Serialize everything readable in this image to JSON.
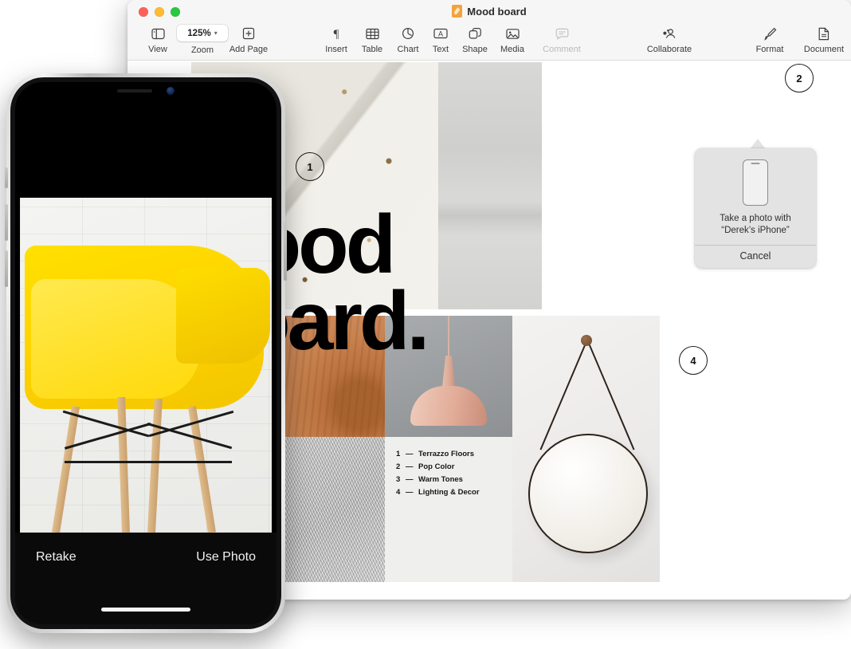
{
  "window": {
    "title": "Mood board",
    "doc_icon": "pages-document-icon",
    "traffic_lights": [
      {
        "name": "close",
        "color": "#ff5f57"
      },
      {
        "name": "minimize",
        "color": "#febc2e"
      },
      {
        "name": "maximize",
        "color": "#28c840"
      }
    ]
  },
  "toolbar": {
    "view": {
      "label": "View",
      "icon": "sidebar-icon"
    },
    "zoom": {
      "label": "Zoom",
      "value": "125%",
      "icon": "chevron-down-icon"
    },
    "add_page": {
      "label": "Add Page",
      "icon": "plus-square-icon"
    },
    "insert": {
      "label": "Insert",
      "icon": "pilcrow-icon"
    },
    "table": {
      "label": "Table",
      "icon": "table-grid-icon"
    },
    "chart": {
      "label": "Chart",
      "icon": "pie-chart-icon"
    },
    "text": {
      "label": "Text",
      "icon": "text-box-icon"
    },
    "shape": {
      "label": "Shape",
      "icon": "shapes-icon"
    },
    "media": {
      "label": "Media",
      "icon": "photo-icon"
    },
    "comment": {
      "label": "Comment",
      "icon": "comment-bubble-icon",
      "disabled": true
    },
    "collaborate": {
      "label": "Collaborate",
      "icon": "person-add-icon"
    },
    "format": {
      "label": "Format",
      "icon": "paintbrush-icon"
    },
    "document": {
      "label": "Document",
      "icon": "document-page-icon"
    }
  },
  "board": {
    "headline_line1": "Mood",
    "headline_line2": "Board.",
    "markers": [
      {
        "id": "1",
        "label": "1"
      },
      {
        "id": "2",
        "label": "2"
      },
      {
        "id": "4",
        "label": "4"
      }
    ],
    "legend": [
      {
        "num": "1",
        "dash": "—",
        "label": "Terrazzo Floors"
      },
      {
        "num": "2",
        "dash": "—",
        "label": "Pop Color"
      },
      {
        "num": "3",
        "dash": "—",
        "label": "Warm Tones"
      },
      {
        "num": "4",
        "dash": "—",
        "label": "Lighting & Decor"
      }
    ]
  },
  "continuity_popover": {
    "icon": "iphone-icon",
    "line1": "Take a photo with",
    "line2": "“Derek’s iPhone”",
    "cancel_label": "Cancel"
  },
  "iphone": {
    "retake_label": "Retake",
    "use_photo_label": "Use Photo"
  },
  "colors": {
    "accent_yellow": "#ffd400",
    "toolbar_bg": "#f6f6f6",
    "popover_bg": "#e3e3e3",
    "doc_icon": "#f2a33c"
  }
}
